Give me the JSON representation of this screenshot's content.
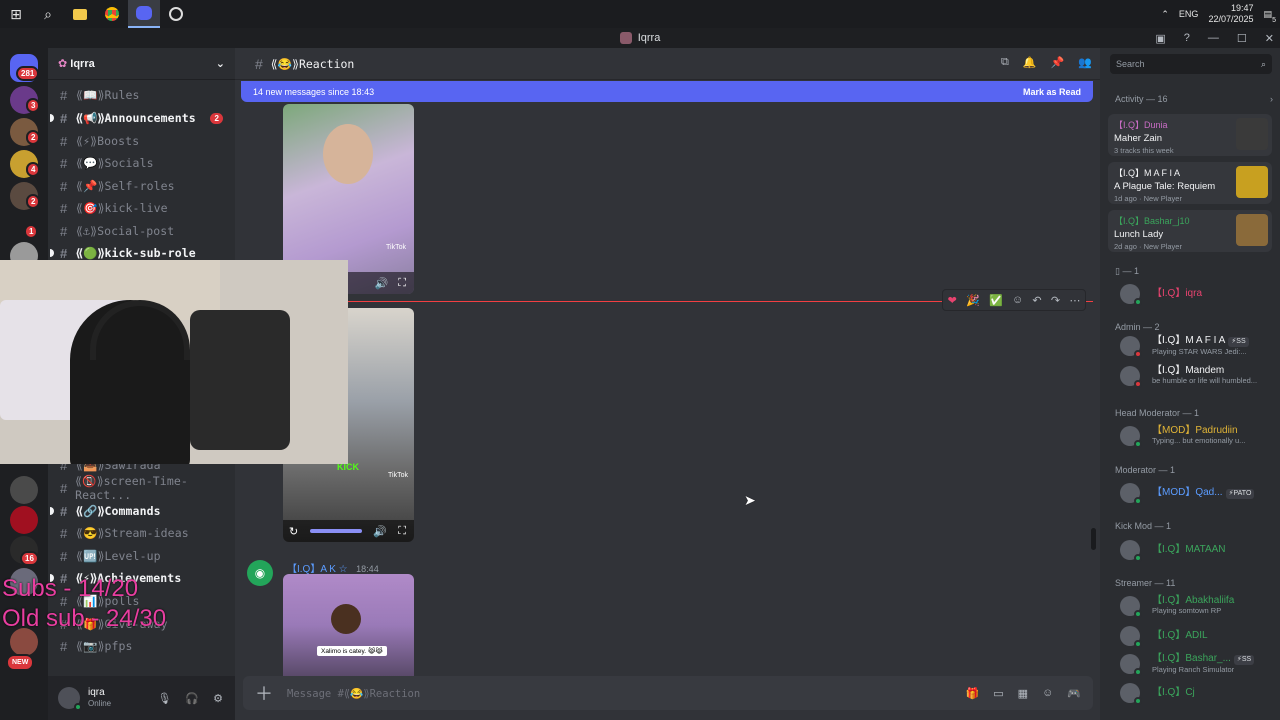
{
  "taskbar": {
    "icons": [
      "windows-icon",
      "search-icon",
      "file-explorer-icon",
      "chrome-icon",
      "discord-icon",
      "app-icon"
    ],
    "lang": "ENG",
    "time": "19:47",
    "date": "22/07/2025",
    "notif_count": "5"
  },
  "titlebar": {
    "title": "Iqrra"
  },
  "rail": {
    "home_badge": "281",
    "badges": [
      "3",
      "2",
      "4",
      "2",
      "1",
      "16"
    ],
    "new_label": "NEW"
  },
  "server": {
    "name": "Iqrra"
  },
  "channels": [
    {
      "label": "⟪📖⟫Rules",
      "bold": false
    },
    {
      "label": "⟪📢⟫Announcements",
      "bold": true,
      "badge": "2"
    },
    {
      "label": "⟪⚡⟫Boosts",
      "bold": false
    },
    {
      "label": "⟪💬⟫Socials",
      "bold": false
    },
    {
      "label": "⟪📌⟫Self-roles",
      "bold": false
    },
    {
      "label": "⟪🎯⟫kick-live",
      "bold": false
    },
    {
      "label": "⟪⚓⟫Social-post",
      "bold": false
    },
    {
      "label": "⟪🟢⟫kick-sub-role",
      "bold": true
    },
    {
      "label": "⟪📥⟫Sawirada",
      "bold": false
    },
    {
      "label": "⟪📵⟫screen-Time-React...",
      "bold": false
    },
    {
      "label": "⟪🔗⟫Commands",
      "bold": true
    },
    {
      "label": "⟪😎⟫Stream-ideas",
      "bold": false
    },
    {
      "label": "⟪🆙⟫Level-up",
      "bold": false
    },
    {
      "label": "⟪⚡⟫Achievements",
      "bold": true
    },
    {
      "label": "⟪📊⟫polls",
      "bold": false
    },
    {
      "label": "⟪🎁⟫Give-away",
      "bold": false
    },
    {
      "label": "⟪📷⟫pfps",
      "bold": false
    }
  ],
  "user": {
    "name": "iqra",
    "status": "Online"
  },
  "main": {
    "channel_title": "⟪😂⟫Reaction",
    "new_messages": "14 new messages since 18:43",
    "mark_read": "Mark as Read",
    "tiktok": "TikTok",
    "kick_label": "KICK",
    "video_caption": "Xalimo is catey. 😹😹",
    "msg_author": "【I.Q】A K ☆",
    "msg_time": "18:44",
    "composer_placeholder": "Message #⟪😂⟫Reaction"
  },
  "members": {
    "search_placeholder": "Search",
    "activity_header": "Activity — 16",
    "activity": [
      {
        "who": "【I.Q】Dunia",
        "title": "Maher Zain",
        "sub": "3 tracks this week",
        "color": "#c86cc4"
      },
      {
        "who": "【I.Q】M A F I A",
        "title": "A Plague Tale: Requiem",
        "sub": "1d ago  ·  New Player",
        "color": "#f2f3f5"
      },
      {
        "who": "【I.Q】Bashar_j10",
        "title": "Lunch Lady",
        "sub": "2d ago  ·  New Player",
        "color": "#3ba55c"
      }
    ],
    "groups": [
      {
        "label": "▯ — 1",
        "members": [
          {
            "name": "【I.Q】iqra",
            "status": "",
            "color": "#e8436f",
            "tag": ""
          }
        ]
      },
      {
        "label": "Admin — 2",
        "members": [
          {
            "name": "【I.Q】M A F I A",
            "status": "Playing STAR WARS Jedi:...",
            "color": "#f2f3f5",
            "tag": "⚡SS"
          },
          {
            "name": "【I.Q】Mandem",
            "status": "be humble or life will humbled...",
            "color": "#f2f3f5",
            "tag": ""
          }
        ]
      },
      {
        "label": "Head Moderator — 1",
        "members": [
          {
            "name": "【MOD】Padrudiin",
            "status": "Typing... but emotionally u...",
            "color": "#e0b437",
            "tag": ""
          }
        ]
      },
      {
        "label": "Moderator — 1",
        "members": [
          {
            "name": "【MOD】Qad...",
            "status": "",
            "color": "#5b9cff",
            "tag": "⚡PATO"
          }
        ]
      },
      {
        "label": "Kick Mod — 1",
        "members": [
          {
            "name": "【I.Q】MATAAN",
            "status": "",
            "color": "#3ba55c",
            "tag": ""
          }
        ]
      },
      {
        "label": "Streamer — 11",
        "members": [
          {
            "name": "【I.Q】Abakhaliifa",
            "status": "Playing somtown RP",
            "color": "#3ba55c",
            "tag": ""
          },
          {
            "name": "【I.Q】ADIL",
            "status": "",
            "color": "#3ba55c",
            "tag": ""
          },
          {
            "name": "【I.Q】Bashar_...",
            "status": "Playing Ranch Simulator",
            "color": "#3ba55c",
            "tag": "⚡SS"
          },
          {
            "name": "【I.Q】Cj",
            "status": "",
            "color": "#3ba55c",
            "tag": ""
          }
        ]
      }
    ]
  },
  "overlay": {
    "subs": "Subs - 14/20",
    "old_subs": "Old sub - 24/30"
  }
}
